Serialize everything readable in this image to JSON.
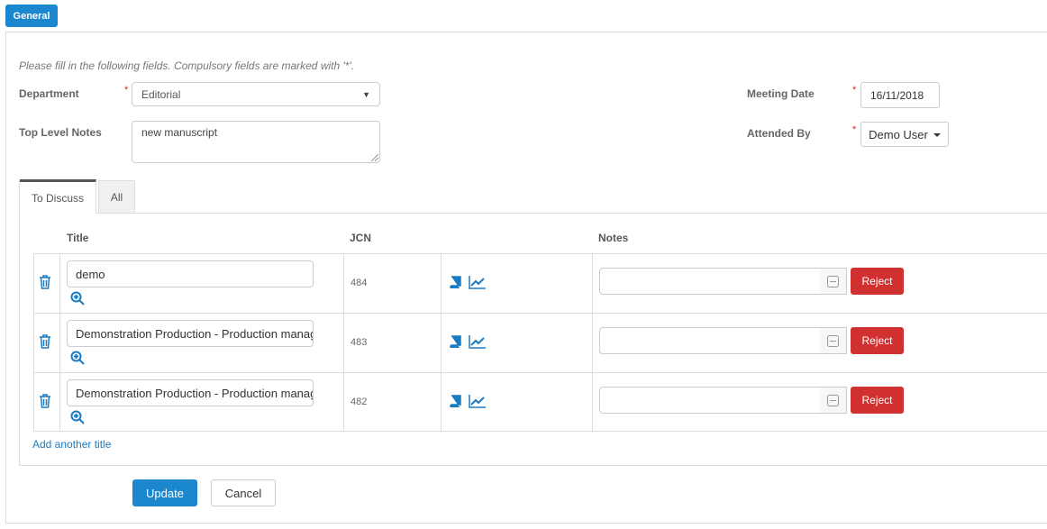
{
  "top_tab": {
    "label": "General"
  },
  "form": {
    "instruction": "Please fill in the following fields. Compulsory fields are marked with '*'.",
    "required_mark": "*",
    "department": {
      "label": "Department",
      "value": "Editorial"
    },
    "top_level_notes": {
      "label": "Top Level Notes",
      "value": "new manuscript"
    },
    "meeting_date": {
      "label": "Meeting Date",
      "value": "16/11/2018"
    },
    "attended_by": {
      "label": "Attended By",
      "value": "Demo User"
    }
  },
  "tabs": [
    {
      "label": "To Discuss",
      "active": true
    },
    {
      "label": "All",
      "active": false
    }
  ],
  "grid": {
    "headers": {
      "title": "Title",
      "jcn": "JCN",
      "notes": "Notes"
    },
    "rows": [
      {
        "title": "demo",
        "jcn": "484",
        "notes": "",
        "reject_label": "Reject"
      },
      {
        "title": "Demonstration Production - Production manag",
        "jcn": "483",
        "notes": "",
        "reject_label": "Reject"
      },
      {
        "title": "Demonstration Production - Production manag",
        "jcn": "482",
        "notes": "",
        "reject_label": "Reject"
      }
    ]
  },
  "add_title_link": "Add another title",
  "actions": {
    "update_label": "Update",
    "cancel_label": "Cancel"
  },
  "colors": {
    "primary": "#1a87cf",
    "danger": "#d0302f",
    "link": "#1a7bc2"
  },
  "icons": [
    "trash-icon",
    "zoom-in-icon",
    "book-icon",
    "trend-chart-icon",
    "minus-square-icon",
    "caret-down-icon"
  ]
}
